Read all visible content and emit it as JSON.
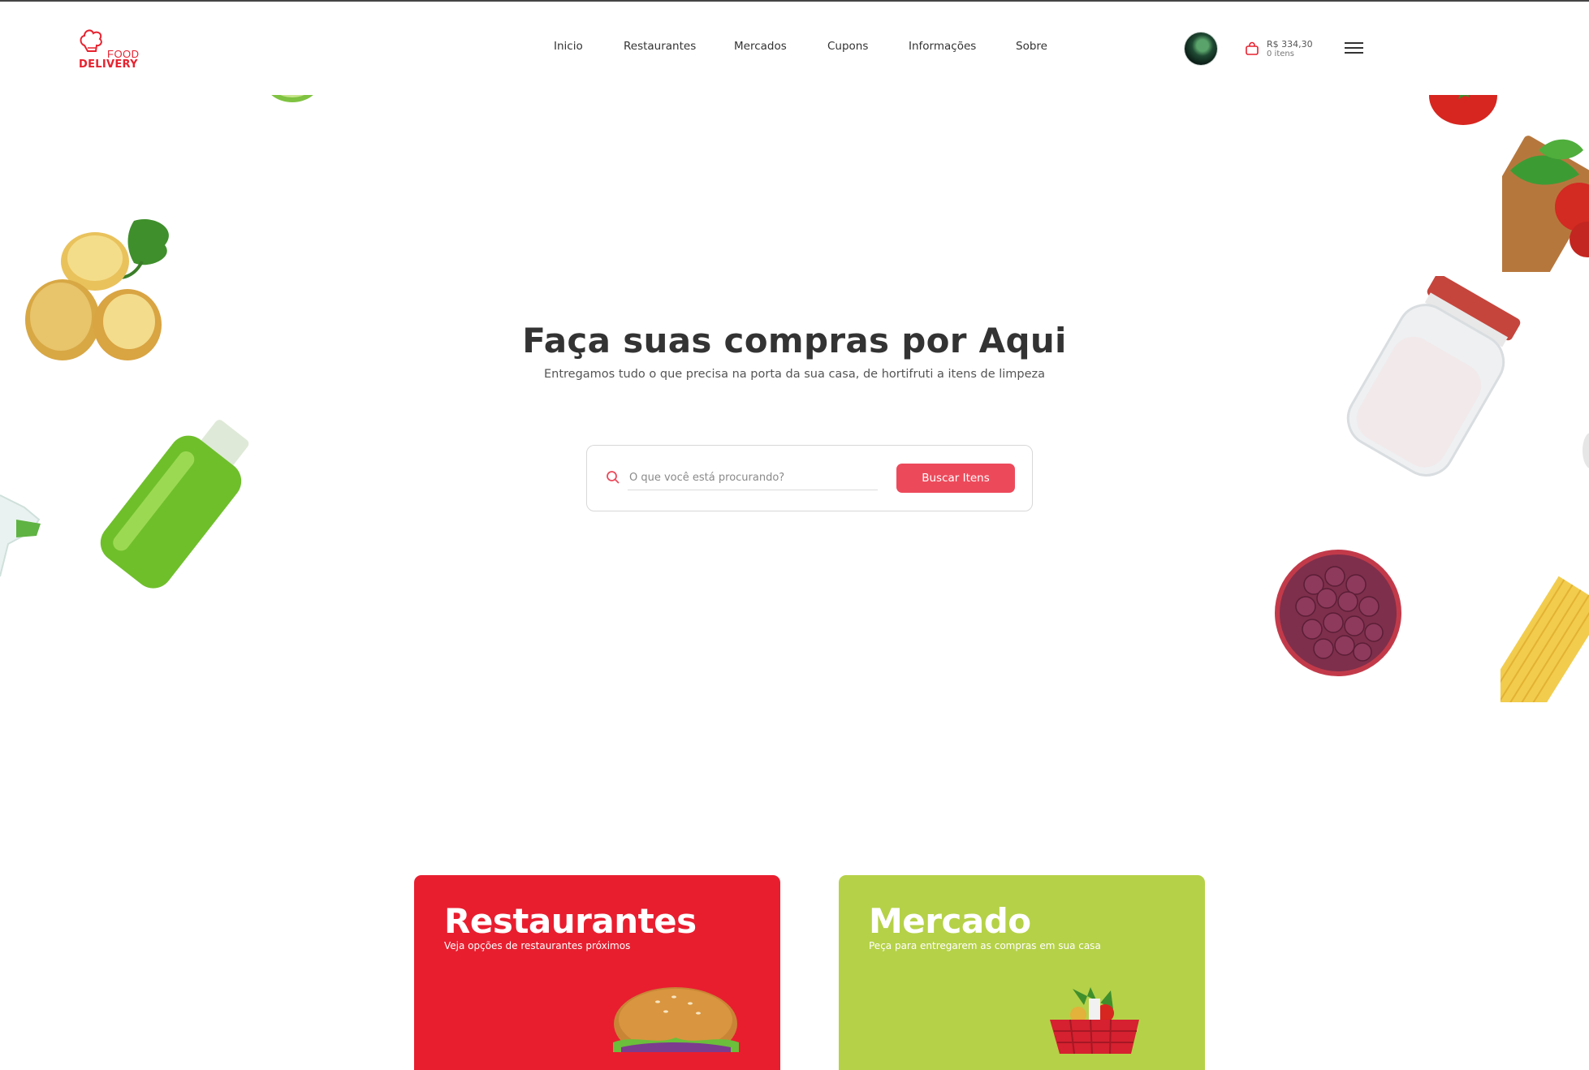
{
  "brand": {
    "logo_food": "FOOD",
    "logo_delivery": "DELIVERY",
    "color": "#e8212e"
  },
  "nav": {
    "items": [
      {
        "label": "Inicio"
      },
      {
        "label": "Restaurantes"
      },
      {
        "label": "Mercados"
      },
      {
        "label": "Cupons"
      },
      {
        "label": "Informações"
      },
      {
        "label": "Sobre"
      }
    ]
  },
  "cart": {
    "total": "R$ 334,30",
    "items": "0 itens",
    "icon": "shopping-bag-icon"
  },
  "menu": {
    "icon": "hamburger-menu-icon"
  },
  "hero": {
    "title": "Faça suas compras por Aqui",
    "subtitle": "Entregamos tudo o que precisa na porta da sua casa, de hortifruti a itens de limpeza"
  },
  "search": {
    "placeholder": "O que você está procurando?",
    "button_label": "Buscar Itens",
    "icon": "search-icon"
  },
  "cards": [
    {
      "title": "Restaurantes",
      "subtitle": "Veja opções de restaurantes próximos",
      "color": "#e81e2f"
    },
    {
      "title": "Mercado",
      "subtitle": "Peça para entregarem as compras em sua casa",
      "color": "#b5d148"
    }
  ],
  "accent_color": "#ec4a5b"
}
